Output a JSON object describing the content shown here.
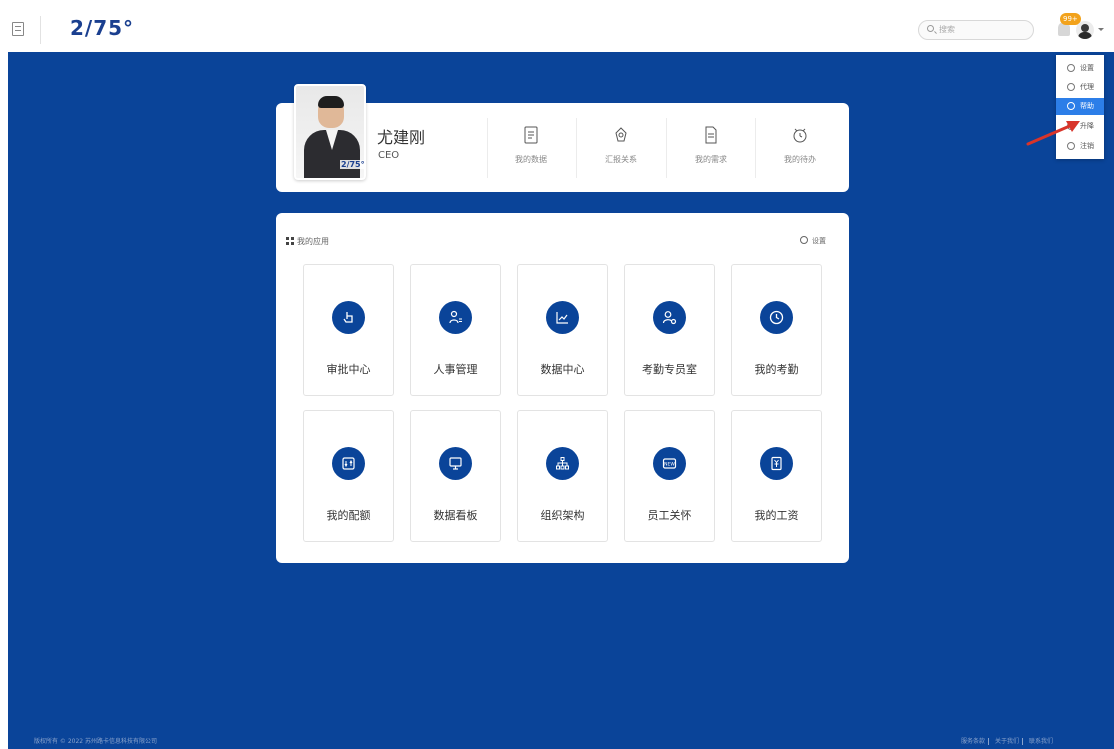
{
  "header": {
    "logo": "2/75°",
    "search_placeholder": "搜索",
    "notification_badge": "99+"
  },
  "dropdown": {
    "items": [
      {
        "label": "设置",
        "icon": "gear-icon"
      },
      {
        "label": "代理",
        "icon": "proxy-icon"
      },
      {
        "label": "帮助",
        "icon": "help-icon",
        "active": true
      },
      {
        "label": "升降",
        "icon": "switch-icon"
      },
      {
        "label": "注销",
        "icon": "logout-icon"
      }
    ]
  },
  "profile": {
    "name": "尤建刚",
    "title": "CEO",
    "photo_logo": "2/75°",
    "quick_links": [
      {
        "label": "我的数据",
        "icon": "document-icon"
      },
      {
        "label": "汇报关系",
        "icon": "relation-icon"
      },
      {
        "label": "我的需求",
        "icon": "file-icon"
      },
      {
        "label": "我的待办",
        "icon": "alarm-clock-icon"
      }
    ]
  },
  "apps": {
    "title": "我的应用",
    "settings_label": "设置",
    "tiles": [
      {
        "label": "审批中心",
        "icon": "hand-pointer-icon"
      },
      {
        "label": "人事管理",
        "icon": "user-list-icon"
      },
      {
        "label": "数据中心",
        "icon": "line-chart-icon"
      },
      {
        "label": "考勤专员室",
        "icon": "user-gear-icon"
      },
      {
        "label": "我的考勤",
        "icon": "clock-icon"
      },
      {
        "label": "我的配额",
        "icon": "quota-icon"
      },
      {
        "label": "数据看板",
        "icon": "monitor-icon"
      },
      {
        "label": "组织架构",
        "icon": "org-chart-icon"
      },
      {
        "label": "员工关怀",
        "icon": "new-badge-icon"
      },
      {
        "label": "我的工资",
        "icon": "salary-icon"
      }
    ]
  },
  "footer": {
    "copyright": "版权所有 © 2022 苏州路卡信息科技有限公司",
    "links": [
      "服务条款",
      "关于我们",
      "联系我们"
    ]
  }
}
